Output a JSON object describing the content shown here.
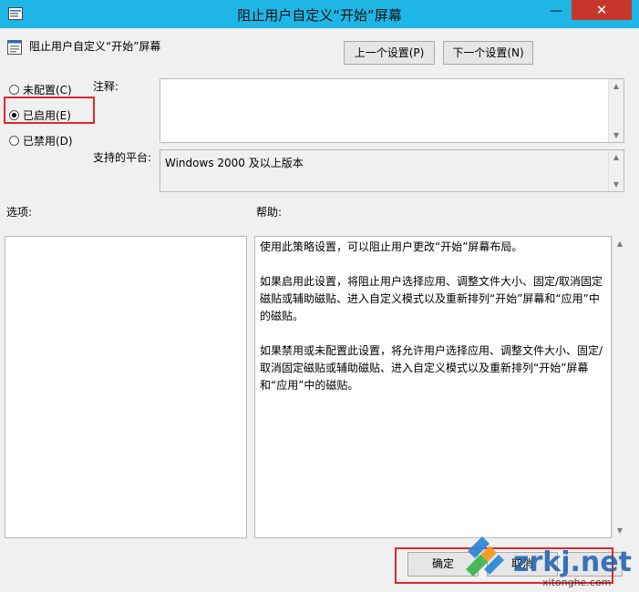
{
  "window": {
    "title": "阻止用户自定义“开始”屏幕"
  },
  "header": {
    "policy_name": "阻止用户自定义“开始”屏幕",
    "prev_label": "上一个设置(P)",
    "next_label": "下一个设置(N)"
  },
  "radios": [
    {
      "label": "未配置(C)",
      "checked": false
    },
    {
      "label": "已启用(E)",
      "checked": true
    },
    {
      "label": "已禁用(D)",
      "checked": false
    }
  ],
  "comment": {
    "label": "注释:",
    "value": ""
  },
  "platform": {
    "label": "支持的平台:",
    "value": "Windows 2000 及以上版本"
  },
  "options": {
    "label": "选项:"
  },
  "help": {
    "label": "帮助:",
    "paragraphs": [
      "使用此策略设置，可以阻止用户更改“开始”屏幕布局。",
      "如果启用此设置，将阻止用户选择应用、调整文件大小、固定/取消固定磁贴或辅助磁贴、进入自定义模式以及重新排列“开始”屏幕和“应用”中的磁贴。",
      "如果禁用或未配置此设置，将允许用户选择应用、调整文件大小、固定/取消固定磁贴或辅助磁贴、进入自定义模式以及重新排列“开始”屏幕和“应用”中的磁贴。"
    ]
  },
  "footer": {
    "ok_label": "确定",
    "cancel_label": "取消",
    "apply_label": ""
  },
  "watermark": {
    "text": "zrkj.net",
    "subtext": "xitonghe.com"
  },
  "colors": {
    "titlebar": "#1fb6e6",
    "close": "#c7362b",
    "highlight": "#e3262b"
  }
}
